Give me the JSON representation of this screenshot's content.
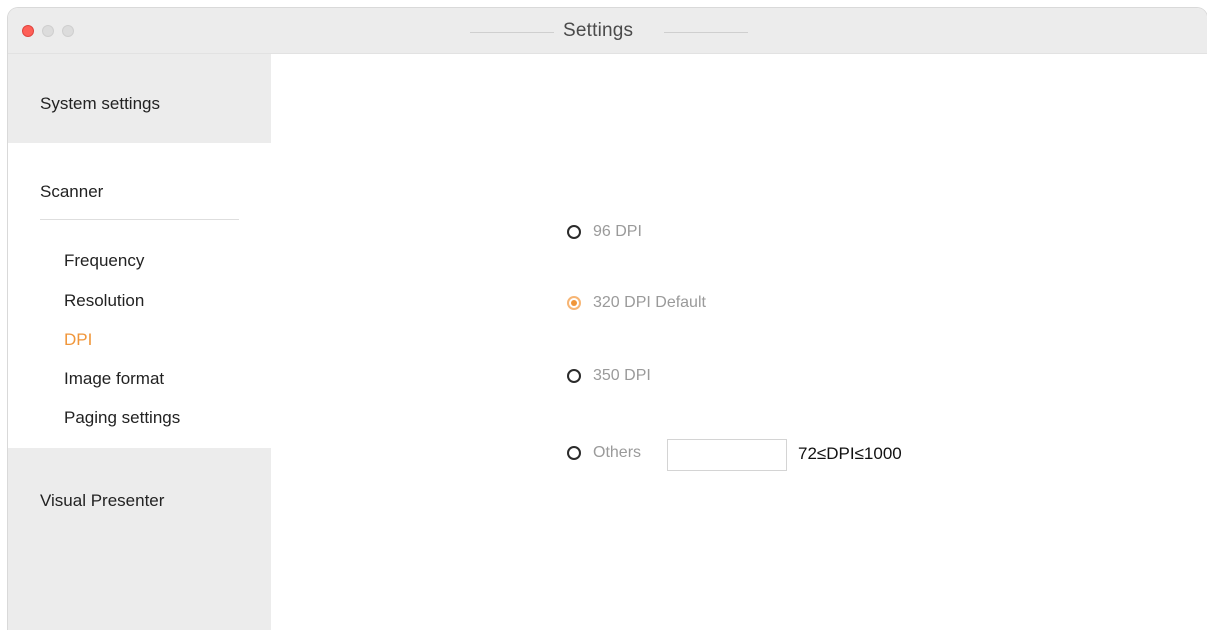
{
  "window": {
    "title": "Settings"
  },
  "sidebar": {
    "system_settings": "System settings",
    "scanner": "Scanner",
    "visual_presenter": "Visual Presenter",
    "sub_items": [
      {
        "label": "Frequency",
        "active": false
      },
      {
        "label": "Resolution",
        "active": false
      },
      {
        "label": "DPI",
        "active": true
      },
      {
        "label": "Image format",
        "active": false
      },
      {
        "label": "Paging settings",
        "active": false
      }
    ]
  },
  "dpi": {
    "options": [
      {
        "label": "96 DPI",
        "selected": false
      },
      {
        "label": "320 DPI Default",
        "selected": true
      },
      {
        "label": "350 DPI",
        "selected": false
      },
      {
        "label": "Others",
        "selected": false
      }
    ],
    "others_value": "",
    "range_hint": "72≤DPI≤1000"
  },
  "colors": {
    "accent": "#f0963a",
    "sidebar_bg": "#ececec",
    "close_button": "#fe5f57"
  },
  "icons": {
    "close": "close-traffic-light",
    "minimize": "minimize-traffic-light",
    "maximize": "maximize-traffic-light"
  }
}
